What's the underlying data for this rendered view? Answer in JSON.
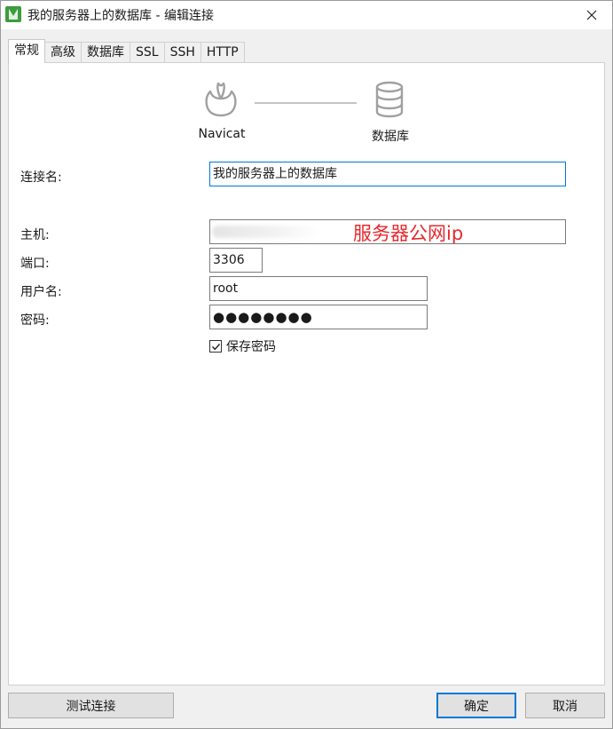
{
  "window": {
    "title": "我的服务器上的数据库 - 编辑连接"
  },
  "tabs": [
    {
      "label": "常规",
      "active": true
    },
    {
      "label": "高级"
    },
    {
      "label": "数据库"
    },
    {
      "label": "SSL"
    },
    {
      "label": "SSH"
    },
    {
      "label": "HTTP"
    }
  ],
  "diagram": {
    "source_label": "Navicat",
    "target_label": "数据库"
  },
  "form": {
    "connection_name_label": "连接名:",
    "connection_name_value": "我的服务器上的数据库",
    "host_label": "主机:",
    "host_annotation": "服务器公网ip",
    "port_label": "端口:",
    "port_value": "3306",
    "username_label": "用户名:",
    "username_value": "root",
    "password_label": "密码:",
    "password_value": "●●●●●●●●",
    "save_password_label": "保存密码",
    "save_password_checked": true
  },
  "buttons": {
    "test": "测试连接",
    "ok": "确定",
    "cancel": "取消"
  },
  "colors": {
    "annotation": "#e8282d",
    "focus": "#0078d7",
    "logo": "#3c9d3c"
  }
}
